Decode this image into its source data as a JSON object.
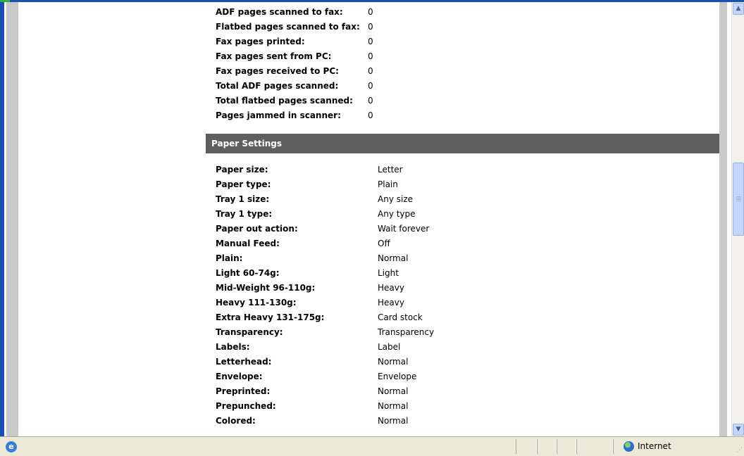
{
  "scan_rows": [
    {
      "label": "ADF pages scanned to fax:",
      "value": "0"
    },
    {
      "label": "Flatbed pages scanned to fax:",
      "value": "0"
    },
    {
      "label": "Fax pages printed:",
      "value": "0"
    },
    {
      "label": "Fax pages sent from PC:",
      "value": "0"
    },
    {
      "label": "Fax pages received to PC:",
      "value": "0"
    },
    {
      "label": "Total ADF pages scanned:",
      "value": "0"
    },
    {
      "label": "Total flatbed pages scanned:",
      "value": "0"
    },
    {
      "label": "Pages jammed in scanner:",
      "value": "0"
    }
  ],
  "paper_settings": {
    "title": "Paper Settings",
    "rows": [
      {
        "label": "Paper size:",
        "value": "Letter"
      },
      {
        "label": "Paper type:",
        "value": "Plain"
      },
      {
        "label": "Tray 1 size:",
        "value": "Any size"
      },
      {
        "label": "Tray 1 type:",
        "value": "Any type"
      },
      {
        "label": "Paper out action:",
        "value": "Wait forever"
      },
      {
        "label": "Manual Feed:",
        "value": "Off"
      },
      {
        "label": "Plain:",
        "value": "Normal"
      },
      {
        "label": "Light 60-74g:",
        "value": "Light"
      },
      {
        "label": "Mid-Weight 96-110g:",
        "value": "Heavy"
      },
      {
        "label": "Heavy 111-130g:",
        "value": "Heavy"
      },
      {
        "label": "Extra Heavy 131-175g:",
        "value": "Card stock"
      },
      {
        "label": "Transparency:",
        "value": "Transparency"
      },
      {
        "label": "Labels:",
        "value": "Label"
      },
      {
        "label": "Letterhead:",
        "value": "Normal"
      },
      {
        "label": "Envelope:",
        "value": "Envelope"
      },
      {
        "label": "Preprinted:",
        "value": "Normal"
      },
      {
        "label": "Prepunched:",
        "value": "Normal"
      },
      {
        "label": "Colored:",
        "value": "Normal"
      }
    ]
  },
  "statusbar": {
    "zone_label": "Internet",
    "icons": {
      "page": "ie-page-icon",
      "zone": "globe-icon"
    }
  },
  "colors": {
    "section_bar": "#5e5e5e",
    "frame_blue": "#1a4fb6",
    "sidebar_gray": "#c9c9c9"
  },
  "scroll_position": 0.37
}
